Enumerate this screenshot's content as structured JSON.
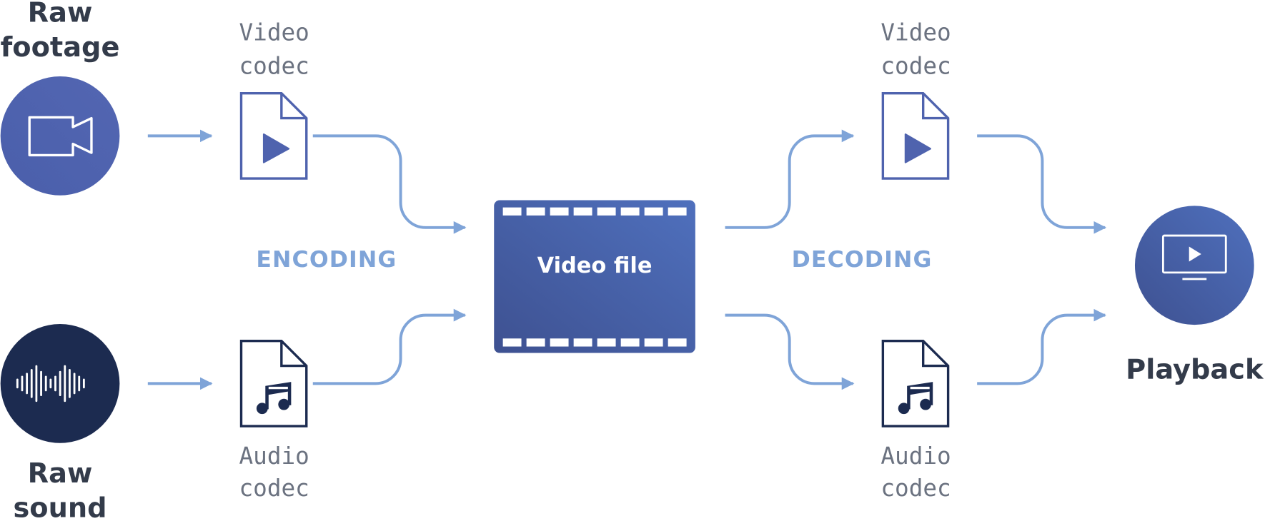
{
  "colors": {
    "accent": "#4f63ae",
    "navy": "#1c2b50",
    "arrow": "#7fa4d8",
    "text": "#333b4a",
    "mono": "#6b7280"
  },
  "inputs": {
    "video": {
      "label_line1": "Raw",
      "label_line2": "footage",
      "icon": "video-camera-icon"
    },
    "audio": {
      "label_line1": "Raw",
      "label_line2": "sound",
      "icon": "sound-wave-icon"
    }
  },
  "encoding": {
    "label": "ENCODING",
    "video_codec": {
      "line1": "Video",
      "line2": "codec",
      "icon": "video-file-icon"
    },
    "audio_codec": {
      "line1": "Audio",
      "line2": "codec",
      "icon": "audio-file-icon"
    }
  },
  "container": {
    "label": "Video file",
    "icon": "film-strip-icon"
  },
  "decoding": {
    "label": "DECODING",
    "video_codec": {
      "line1": "Video",
      "line2": "codec",
      "icon": "video-file-icon"
    },
    "audio_codec": {
      "line1": "Audio",
      "line2": "codec",
      "icon": "audio-file-icon"
    }
  },
  "output": {
    "label": "Playback",
    "icon": "monitor-play-icon"
  }
}
